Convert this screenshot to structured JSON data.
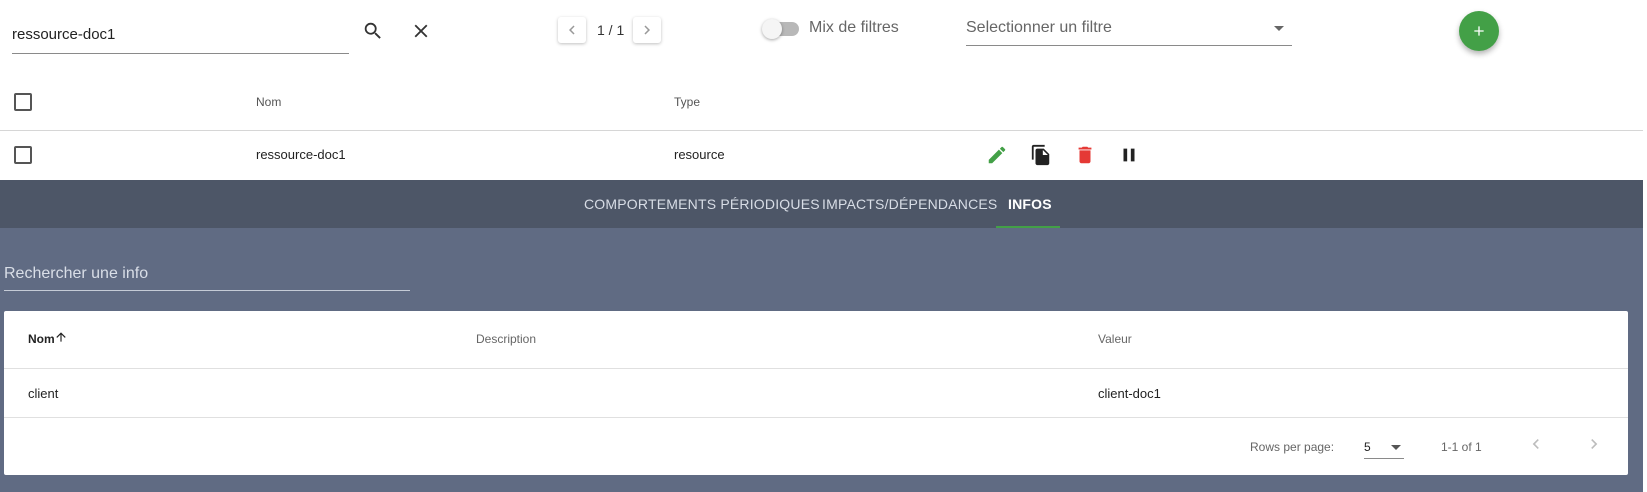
{
  "toolbar": {
    "search_value": "ressource-doc1",
    "pagination": "1 / 1",
    "mix_filters_label": "Mix de filtres",
    "mix_filters_enabled": false,
    "filter_select_placeholder": "Selectionner un filtre",
    "add_label": "+"
  },
  "table": {
    "headers": {
      "name": "Nom",
      "type": "Type"
    },
    "rows": [
      {
        "name": "ressource-doc1",
        "type": "resource"
      }
    ]
  },
  "panel": {
    "tabs": [
      {
        "label": "COMPORTEMENTS PÉRIODIQUES"
      },
      {
        "label": "IMPACTS/DÉPENDANCES"
      },
      {
        "label": "INFOS",
        "active": true
      }
    ],
    "search_placeholder": "Rechercher une info",
    "infos": {
      "headers": {
        "name": "Nom",
        "description": "Description",
        "value": "Valeur"
      },
      "rows": [
        {
          "name": "client",
          "description": "",
          "value": "client-doc1"
        }
      ],
      "footer": {
        "rows_per_page_label": "Rows per page:",
        "rows_per_page_value": "5",
        "range": "1-1 of 1"
      }
    }
  },
  "colors": {
    "accent_green": "#43a047",
    "danger_red": "#e53935",
    "tabbar_bg": "#4d5667",
    "panel_bg": "#606b83"
  },
  "icons": [
    "search-icon",
    "close-icon",
    "chevron-left-icon",
    "chevron-right-icon",
    "chevron-down-icon",
    "plus-icon",
    "edit-icon",
    "copy-icon",
    "delete-icon",
    "pause-icon",
    "arrow-up-icon"
  ]
}
